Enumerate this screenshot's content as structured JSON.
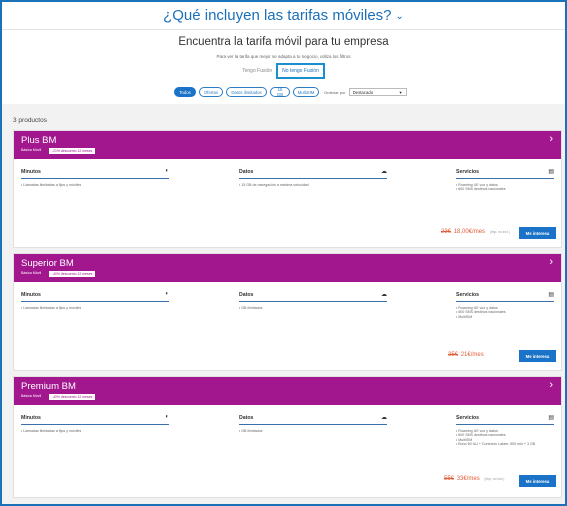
{
  "header": {
    "title": "¿Qué incluyen las tarifas móviles?"
  },
  "hero": {
    "heading": "Encuentra la tarifa móvil para tu empresa",
    "subtitle": "Para ver la tarifa que mejor se adapta a tu negocio, utiliza los filtros",
    "toggle_options": [
      "Tengo Fusión",
      "No tengo Fusión"
    ]
  },
  "filters": {
    "pills": [
      "Todos",
      "Ofertas",
      "Datos ilimitados",
      "15 GB",
      "MultiSIM"
    ],
    "active": "Todos",
    "order_label": "Ordenar por",
    "order_value": "Destacado"
  },
  "results_count": "3 productos",
  "colors": {
    "accent": "#a2178e",
    "primary": "#1a73c8",
    "price": "#e05d3a"
  },
  "products": [
    {
      "name": "Plus BM",
      "base": "Básica Móvil",
      "promo": "-21% descuento 12 meses",
      "minutos_label": "Minutos",
      "minutos_text": "• Llamadas ilimitadas a fijos y móviles",
      "datos_label": "Datos",
      "datos_text": "• 15 GB de navegación a máxima velocidad",
      "servicios_label": "Servicios",
      "servicios_text": [
        "• Roaming UE voz y datos",
        "• 600 SMS destinos nacionales"
      ],
      "old_price": "23€",
      "new_price": "18,00€/mes",
      "iva": "(Imp. no incl.)",
      "button": "Me interesa"
    },
    {
      "name": "Superior BM",
      "base": "Básica Móvil",
      "promo": "-40% descuento 12 meses",
      "minutos_label": "Minutos",
      "minutos_text": "• Llamadas ilimitadas a fijos y móviles",
      "datos_label": "Datos",
      "datos_text": "• GB ilimitados",
      "servicios_label": "Servicios",
      "servicios_text": [
        "• Roaming UE voz y datos",
        "• 600 SMS destinos nacionales",
        "• MultiSIM"
      ],
      "old_price": "35€",
      "new_price": "21€/mes",
      "iva": "(Imp. no incl.)",
      "button": "Me interesa"
    },
    {
      "name": "Premium BM",
      "base": "Básica Móvil",
      "promo": "-40% descuento 12 meses",
      "minutos_label": "Minutos",
      "minutos_text": "• Llamadas ilimitadas a fijos y móviles",
      "datos_label": "Datos",
      "datos_text": "• GB ilimitados",
      "servicios_label": "Servicios",
      "servicios_text": [
        "• Roaming UE voz y datos",
        "• 600 SMS destinos nacionales",
        "• MultiSIM",
        "• Bono 60 UU + Conexión Latam: 500 min + 3 GB"
      ],
      "old_price": "55€",
      "new_price": "33€/mes",
      "iva": "(Imp. no incl.)",
      "button": "Me interesa"
    }
  ]
}
